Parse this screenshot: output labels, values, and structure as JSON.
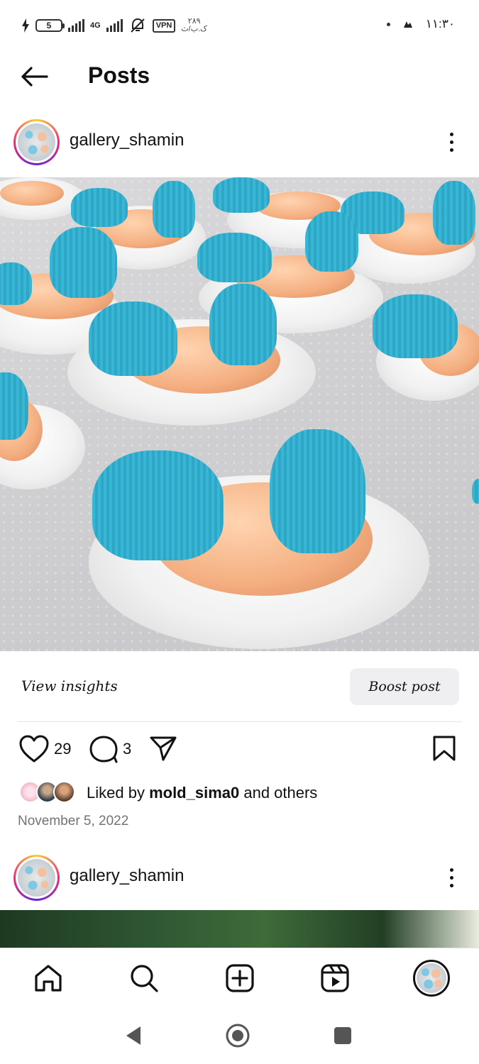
{
  "status_bar": {
    "battery_level": "5",
    "network_type": "4G",
    "vpn_label": "VPN",
    "data_speed_value": "۲۸۹",
    "data_speed_unit": "ک.ب/ث",
    "time": "۱۱:۳۰"
  },
  "header": {
    "title": "Posts"
  },
  "post": {
    "username": "gallery_shamin",
    "insights_label": "View insights",
    "boost_label": "Boost post",
    "like_count": "29",
    "comment_count": "3",
    "liked_by_prefix": "Liked by ",
    "liked_by_user": "mold_sima0",
    "liked_by_suffix": " and others",
    "date": "November 5, 2022"
  },
  "next_post": {
    "username": "gallery_shamin"
  },
  "bottom_nav": {
    "items": [
      "home-icon",
      "search-icon",
      "create-icon",
      "reels-icon",
      "profile-avatar"
    ]
  },
  "colors": {
    "accent_blue": "#38b6d6",
    "text_primary": "#111111",
    "text_secondary": "#737373",
    "boost_bg": "#efeff2"
  }
}
